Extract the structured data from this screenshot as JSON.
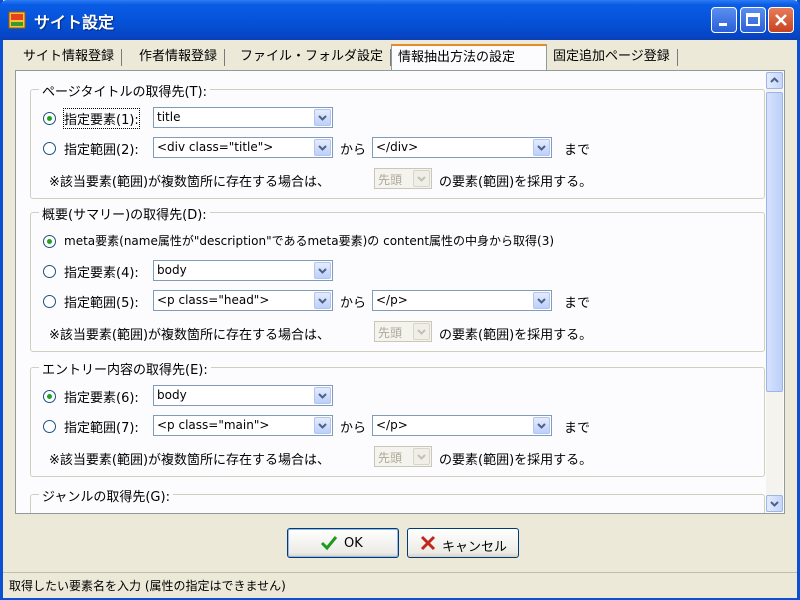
{
  "window": {
    "title": "サイト設定"
  },
  "tabs": [
    {
      "label": "サイト情報登録"
    },
    {
      "label": "作者情報登録"
    },
    {
      "label": "ファイル・フォルダ設定"
    },
    {
      "label": "情報抽出方法の設定"
    },
    {
      "label": "固定追加ページ登録"
    }
  ],
  "sections": {
    "page_title": {
      "legend": "ページタイトルの取得先(T):",
      "opt_element_label": "指定要素(1):",
      "element_value": "title",
      "opt_range_label": "指定範囲(2):",
      "range_start": "<div class=\"title\">",
      "from_label": "から",
      "range_end": "</div>",
      "until_label": "まで",
      "note_prefix": "※該当要素(範囲)が複数箇所に存在する場合は、",
      "note_value": "先頭",
      "note_suffix": "の要素(範囲)を採用する。"
    },
    "summary": {
      "legend": "概要(サマリー)の取得先(D):",
      "opt_meta_label": "meta要素(name属性が\"description\"であるmeta要素)の content属性の中身から取得(3)",
      "opt_element_label": "指定要素(4):",
      "element_value": "body",
      "opt_range_label": "指定範囲(5):",
      "range_start": "<p class=\"head\">",
      "from_label": "から",
      "range_end": "</p>",
      "until_label": "まで",
      "note_prefix": "※該当要素(範囲)が複数箇所に存在する場合は、",
      "note_value": "先頭",
      "note_suffix": "の要素(範囲)を採用する。"
    },
    "entry": {
      "legend": "エントリー内容の取得先(E):",
      "opt_element_label": "指定要素(6):",
      "element_value": "body",
      "opt_range_label": "指定範囲(7):",
      "range_start": "<p class=\"main\">",
      "from_label": "から",
      "range_end": "</p>",
      "until_label": "まで",
      "note_prefix": "※該当要素(範囲)が複数箇所に存在する場合は、",
      "note_value": "先頭",
      "note_suffix": "の要素(範囲)を採用する。"
    },
    "genre": {
      "legend": "ジャンルの取得先(G):"
    }
  },
  "buttons": {
    "ok": "OK",
    "cancel": "キャンセル"
  },
  "status": "取得したい要素名を入力 (属性の指定はできません)"
}
